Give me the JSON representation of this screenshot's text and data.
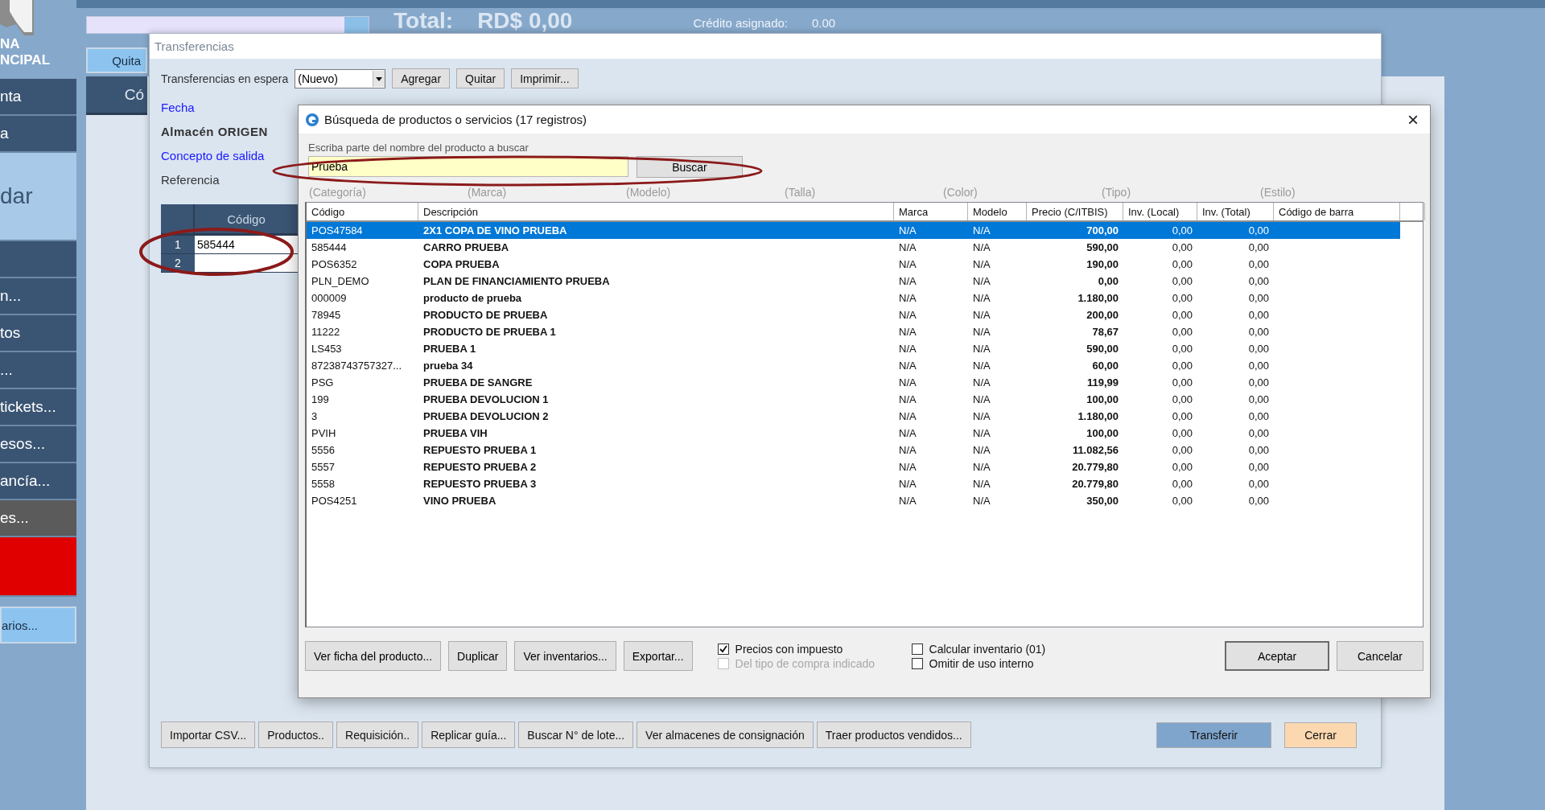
{
  "app": {
    "brand_lines": [
      "NA",
      "NCIPAL"
    ],
    "sidebar": [
      {
        "kind": "dark",
        "label": "nta"
      },
      {
        "kind": "dark",
        "label": "a"
      },
      {
        "kind": "light",
        "label": "dar"
      },
      {
        "kind": "dark"
      },
      {
        "kind": "dark",
        "label": "n..."
      },
      {
        "kind": "dark",
        "label": "tos"
      },
      {
        "kind": "dark",
        "label": "..."
      },
      {
        "kind": "dark",
        "label": "tickets..."
      },
      {
        "kind": "dark",
        "label": "esos..."
      },
      {
        "kind": "dark",
        "label": "ancía..."
      },
      {
        "kind": "grey",
        "label": "es..."
      },
      {
        "kind": "red"
      },
      {
        "kind": "button",
        "label": "arios..."
      }
    ],
    "total_label": "Total:",
    "total_value": "RD$ 0,00",
    "credit_label": "Crédito asignado:",
    "credit_value": "0.00",
    "remove_button": "Quita",
    "grid_header": "Có"
  },
  "transfer_window": {
    "title": "Transferencias",
    "hold_label": "Transferencias en espera",
    "hold_value": "(Nuevo)",
    "hold_buttons": [
      "Agregar",
      "Quitar",
      "Imprimir..."
    ],
    "fields": [
      {
        "kind": "link",
        "label": "Fecha"
      },
      {
        "kind": "bold",
        "label": "Almacén ORIGEN"
      },
      {
        "kind": "link",
        "label": "Concepto de salida"
      },
      {
        "kind": "plain",
        "label": "Referencia"
      }
    ],
    "grid": {
      "header": "Código",
      "rows": [
        {
          "number": "1",
          "code": "585444"
        },
        {
          "number": "2"
        }
      ]
    },
    "bottom_buttons": [
      "Importar CSV...",
      "Productos..",
      "Requisición..",
      "Replicar guía...",
      "Buscar N° de lote...",
      "Ver almacenes de consignación",
      "Traer productos vendidos..."
    ],
    "transfer_button": "Transferir",
    "close_button": "Cerrar"
  },
  "search_dialog": {
    "title": "Búsqueda de productos o servicios (17 registros)",
    "close": "×",
    "search_label": "Escriba parte del nombre del producto a buscar",
    "search_value": "Prueba",
    "search_button": "Buscar",
    "filters": [
      "(Categoría)",
      "(Marca)",
      "(Modelo)",
      "(Talla)",
      "(Color)",
      "(Tipo)",
      "(Estilo)"
    ],
    "columns": [
      "Código",
      "Descripción",
      "Marca",
      "Modelo",
      "Precio (C/ITBIS)",
      "Inv. (Local)",
      "Inv. (Total)",
      "Código de barra"
    ],
    "rows": [
      {
        "code": "POS47584",
        "description": "2X1 COPA DE VINO PRUEBA",
        "brand": "N/A",
        "model": "N/A",
        "price": "700,00",
        "inv_local": "0,00",
        "inv_total": "0,00",
        "selected": true
      },
      {
        "code": "585444",
        "description": "CARRO PRUEBA",
        "brand": "N/A",
        "model": "N/A",
        "price": "590,00",
        "inv_local": "0,00",
        "inv_total": "0,00",
        "selected": false
      },
      {
        "code": "POS6352",
        "description": "COPA PRUEBA",
        "brand": "N/A",
        "model": "N/A",
        "price": "190,00",
        "inv_local": "0,00",
        "inv_total": "0,00",
        "selected": false
      },
      {
        "code": "PLN_DEMO",
        "description": "PLAN DE FINANCIAMIENTO PRUEBA",
        "brand": "N/A",
        "model": "N/A",
        "price": "0,00",
        "inv_local": "0,00",
        "inv_total": "0,00",
        "selected": false
      },
      {
        "code": "000009",
        "description": "producto de prueba",
        "brand": "N/A",
        "model": "N/A",
        "price": "1.180,00",
        "inv_local": "0,00",
        "inv_total": "0,00",
        "selected": false
      },
      {
        "code": "78945",
        "description": "PRODUCTO DE PRUEBA",
        "brand": "N/A",
        "model": "N/A",
        "price": "200,00",
        "inv_local": "0,00",
        "inv_total": "0,00",
        "selected": false
      },
      {
        "code": "11222",
        "description": "PRODUCTO DE PRUEBA 1",
        "brand": "N/A",
        "model": "N/A",
        "price": "78,67",
        "inv_local": "0,00",
        "inv_total": "0,00",
        "selected": false
      },
      {
        "code": "LS453",
        "description": "PRUEBA 1",
        "brand": "N/A",
        "model": "N/A",
        "price": "590,00",
        "inv_local": "0,00",
        "inv_total": "0,00",
        "selected": false
      },
      {
        "code": "87238743757327...",
        "description": "prueba 34",
        "brand": "N/A",
        "model": "N/A",
        "price": "60,00",
        "inv_local": "0,00",
        "inv_total": "0,00",
        "selected": false
      },
      {
        "code": "PSG",
        "description": "PRUEBA DE SANGRE",
        "brand": "N/A",
        "model": "N/A",
        "price": "119,99",
        "inv_local": "0,00",
        "inv_total": "0,00",
        "selected": false
      },
      {
        "code": "199",
        "description": "PRUEBA DEVOLUCION 1",
        "brand": "N/A",
        "model": "N/A",
        "price": "100,00",
        "inv_local": "0,00",
        "inv_total": "0,00",
        "selected": false
      },
      {
        "code": "3",
        "description": "PRUEBA DEVOLUCION 2",
        "brand": "N/A",
        "model": "N/A",
        "price": "1.180,00",
        "inv_local": "0,00",
        "inv_total": "0,00",
        "selected": false
      },
      {
        "code": "PVIH",
        "description": "PRUEBA VIH",
        "brand": "N/A",
        "model": "N/A",
        "price": "100,00",
        "inv_local": "0,00",
        "inv_total": "0,00",
        "selected": false
      },
      {
        "code": "5556",
        "description": "REPUESTO PRUEBA 1",
        "brand": "N/A",
        "model": "N/A",
        "price": "11.082,56",
        "inv_local": "0,00",
        "inv_total": "0,00",
        "selected": false
      },
      {
        "code": "5557",
        "description": "REPUESTO PRUEBA 2",
        "brand": "N/A",
        "model": "N/A",
        "price": "20.779,80",
        "inv_local": "0,00",
        "inv_total": "0,00",
        "selected": false
      },
      {
        "code": "5558",
        "description": "REPUESTO PRUEBA 3",
        "brand": "N/A",
        "model": "N/A",
        "price": "20.779,80",
        "inv_local": "0,00",
        "inv_total": "0,00",
        "selected": false
      },
      {
        "code": "POS4251",
        "description": "VINO PRUEBA",
        "brand": "N/A",
        "model": "N/A",
        "price": "350,00",
        "inv_local": "0,00",
        "inv_total": "0,00",
        "selected": false
      }
    ],
    "action_buttons": [
      "Ver ficha del producto...",
      "Duplicar",
      "Ver inventarios...",
      "Exportar..."
    ],
    "options": [
      [
        {
          "label": "Precios con impuesto",
          "checked": true,
          "disabled": false
        },
        {
          "label": "Del tipo de compra indicado",
          "checked": false,
          "disabled": true
        }
      ],
      [
        {
          "label": "Calcular inventario (01)",
          "checked": false,
          "disabled": false
        },
        {
          "label": "Omitir de uso interno",
          "checked": false,
          "disabled": false
        }
      ]
    ],
    "ok_button": "Aceptar",
    "cancel_button": "Cancelar"
  }
}
